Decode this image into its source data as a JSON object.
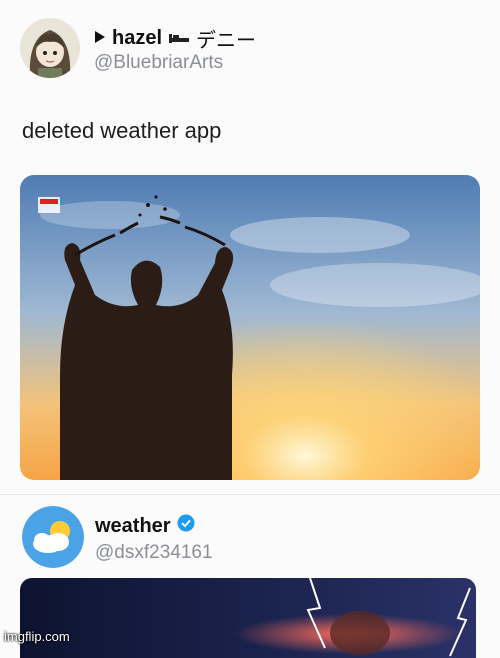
{
  "post": {
    "display_name": "hazel",
    "name_suffix": "デニー",
    "handle": "@BluebriarArts",
    "text": "deleted weather app",
    "avatar_icon": "anime-girl-avatar-icon"
  },
  "reply": {
    "display_name": "weather",
    "handle": "@dsxf234161",
    "avatar_icon": "weather-sun-cloud-icon",
    "verified_icon": "verified-badge-icon",
    "verified_color": "#1d9bf0"
  },
  "watermark": "imgflip.com",
  "colors": {
    "sky_top": "#5b86b8",
    "sky_glow": "#f7c35a",
    "silhouette": "#2b1d16"
  }
}
